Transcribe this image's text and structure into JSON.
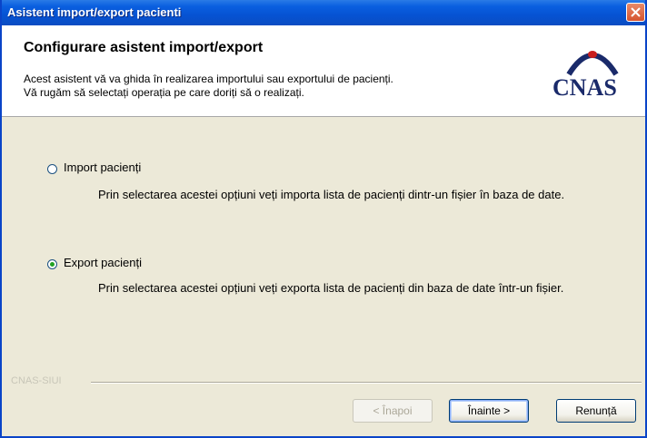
{
  "window": {
    "title": "Asistent import/export pacienti"
  },
  "header": {
    "title": "Configurare asistent import/export",
    "desc_line1": "Acest asistent vă va ghida în realizarea importului sau exportului de pacienți.",
    "desc_line2": "Vă rugăm să selectați operația pe care doriți să o realizați.",
    "logo_text": "CNAS"
  },
  "options": {
    "import": {
      "label": "Import pacienți",
      "desc": "Prin selectarea acestei opțiuni veți importa lista de pacienți dintr-un fișier în baza de date.",
      "selected": false
    },
    "export": {
      "label": "Export pacienți",
      "desc": "Prin selectarea acestei opțiuni veți exporta lista de pacienți din baza de date într-un fișier.",
      "selected": true
    }
  },
  "footer": {
    "label": "CNAS-SIUI"
  },
  "buttons": {
    "back": "< Înapoi",
    "next": "Înainte >",
    "cancel": "Renunță"
  },
  "colors": {
    "titlebar": "#0653d3",
    "window_bg": "#ece9d8",
    "radio_selected": "#21a121",
    "logo": "#1a2a6a"
  }
}
